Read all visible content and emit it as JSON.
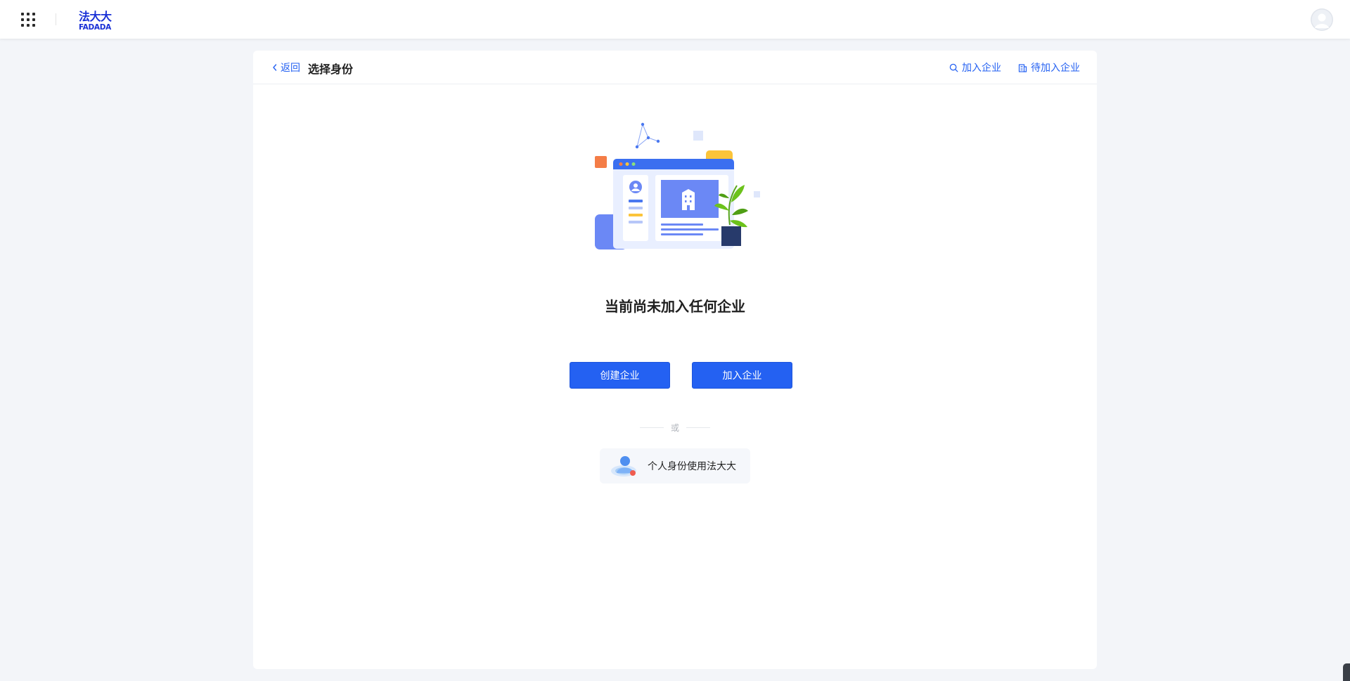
{
  "topbar": {
    "apps_icon": "apps-grid-icon",
    "logo": {
      "cn": "法大大",
      "en": "FADADA",
      "color": "#1930d6"
    },
    "avatar_icon": "user-avatar-icon"
  },
  "header": {
    "back_label": "返回",
    "title": "选择身份",
    "join_link_label": "加入企业",
    "pending_link_label": "待加入企业"
  },
  "main": {
    "empty_title": "当前尚未加入任何企业",
    "create_button_label": "创建企业",
    "join_button_label": "加入企业",
    "or_label": "或",
    "personal_option_label": "个人身份使用法大大"
  },
  "colors": {
    "accent": "#2461f2",
    "page_background": "#f3f5f9",
    "card_background": "#ffffff"
  }
}
